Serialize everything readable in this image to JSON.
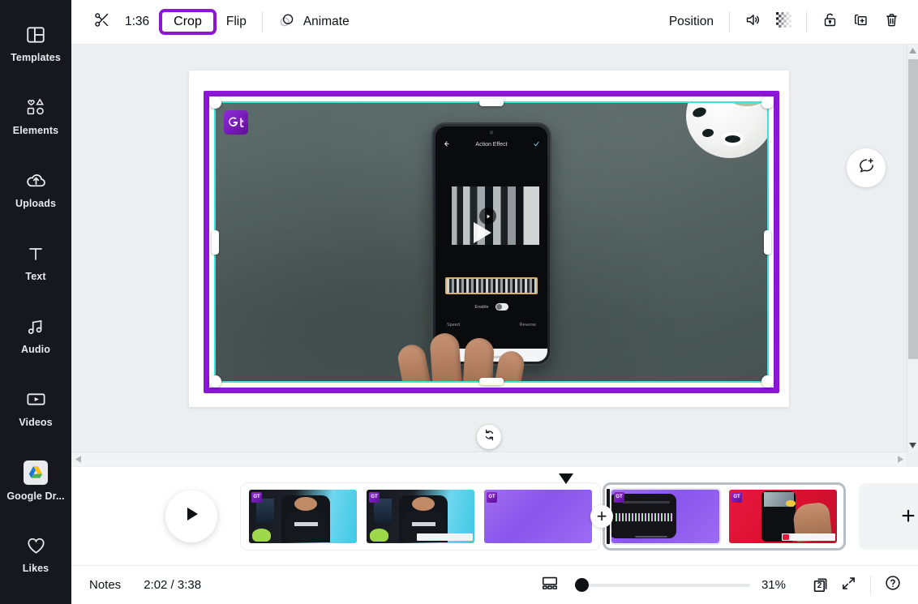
{
  "sidebar": {
    "items": [
      {
        "label": "Templates",
        "icon": "templates-icon"
      },
      {
        "label": "Elements",
        "icon": "elements-icon"
      },
      {
        "label": "Uploads",
        "icon": "uploads-icon"
      },
      {
        "label": "Text",
        "icon": "text-icon"
      },
      {
        "label": "Audio",
        "icon": "audio-icon"
      },
      {
        "label": "Videos",
        "icon": "videos-icon"
      },
      {
        "label": "Google Dr...",
        "icon": "google-drive-icon"
      },
      {
        "label": "Likes",
        "icon": "heart-icon"
      }
    ]
  },
  "toolbar": {
    "scissors_icon": "scissors-icon",
    "duration": "1:36",
    "crop_label": "Crop",
    "flip_label": "Flip",
    "animate_label": "Animate",
    "animate_icon": "animate-rings-icon",
    "position_label": "Position",
    "volume_icon": "speaker-icon",
    "transparency_icon": "transparency-checker-icon",
    "lock_icon": "lock-icon",
    "duplicate_icon": "duplicate-icon",
    "delete_icon": "trash-icon",
    "crop_highlight_color": "#8b16d6"
  },
  "canvas": {
    "crop_frame_color": "#8b16d6",
    "selection_color": "#3fe0dd",
    "watermark": "GT",
    "phone": {
      "screen_title": "Action Effect",
      "back_icon": "back-arrow-icon",
      "confirm_icon": "check-icon",
      "toggle_label": "Enable",
      "left_tab": "Speed",
      "right_tab": "Reverse"
    },
    "comment_icon": "add-comment-icon",
    "rotate_icon": "rotate-icon",
    "scroll": {
      "up_icon": "scroll-up-arrow",
      "down_icon": "scroll-down-arrow",
      "left_icon": "scroll-left-arrow",
      "right_icon": "scroll-right-arrow"
    }
  },
  "timeline": {
    "play_icon": "play-icon",
    "add_between_label": "+",
    "add_page_label": "+",
    "clips": [
      {
        "name": "clip-person-1",
        "kind": "person",
        "selected": false
      },
      {
        "name": "clip-person-2",
        "kind": "person",
        "selected": false
      },
      {
        "name": "clip-purple-1",
        "kind": "purple",
        "selected": false
      },
      {
        "name": "clip-purple-2",
        "kind": "purple",
        "selected": true
      },
      {
        "name": "clip-red-1",
        "kind": "red",
        "selected": true
      }
    ]
  },
  "statusbar": {
    "notes_label": "Notes",
    "time_display": "2:02 / 3:38",
    "timeline_view_icon": "timeline-view-icon",
    "zoom_level": "31%",
    "page_count": "2",
    "pages_icon": "pages-icon",
    "fullscreen_icon": "expand-icon",
    "help_icon": "help-icon"
  }
}
